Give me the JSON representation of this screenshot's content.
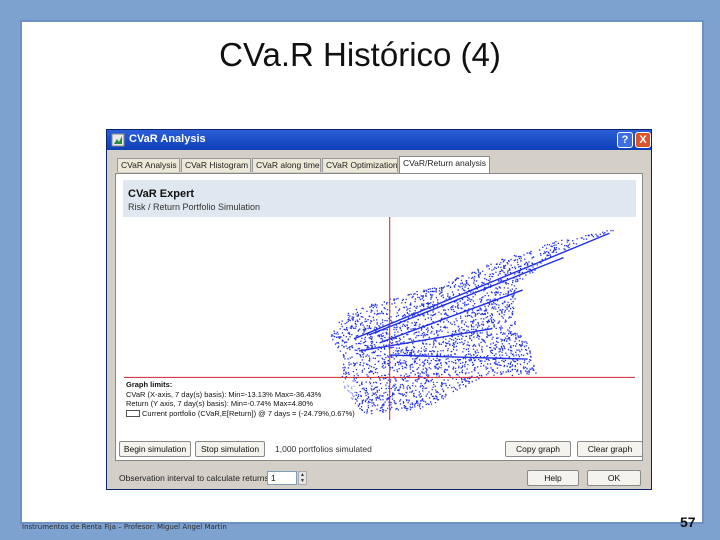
{
  "slide": {
    "title": "CVa.R Histórico (4)",
    "footer": "Instrumentos de Renta Fija – Profesor: Miguel Angel Martín",
    "page_number": "57"
  },
  "window": {
    "title": "CVaR Analysis",
    "help_label": "?",
    "close_label": "X",
    "tabs": [
      {
        "label": "CVaR Analysis"
      },
      {
        "label": "CVaR Histogram"
      },
      {
        "label": "CVaR along time"
      },
      {
        "label": "CVaR Optimization"
      },
      {
        "label": "CVaR/Return analysis",
        "active": true
      }
    ]
  },
  "panel": {
    "header_title": "CVaR Expert",
    "header_subtitle": "Risk / Return Portfolio Simulation",
    "graph_limits": {
      "heading": "Graph limits:",
      "x_line": "CVaR (X-axis, 7 day(s) basis): Min=-13.13% Max=-36.43%",
      "y_line": "Return (Y axis, 7 day(s) basis): Min=-0.74% Max=4.80%",
      "current": "Current portfolio (CVaR,E[Return]) @ 7 days = (-24.79%,0.67%)"
    },
    "scatter_color": "#1f2fe6",
    "crosshair_color": "#c8242e"
  },
  "controls": {
    "begin_label": "Begin simulation",
    "stop_label": "Stop simulation",
    "status_text": "1,000 portfolios simulated",
    "copy_graph_label": "Copy graph",
    "clear_graph_label": "Clear graph",
    "interval_label": "Observation interval to calculate returns:",
    "interval_value": "1",
    "help_label": "Help",
    "ok_label": "OK"
  }
}
